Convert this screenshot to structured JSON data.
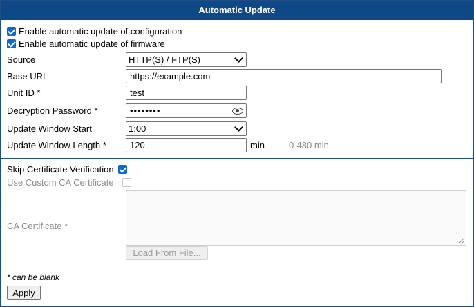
{
  "panel": {
    "title": "Automatic Update"
  },
  "options": {
    "enable_config": {
      "label": "Enable automatic update of configuration",
      "checked": true
    },
    "enable_firmware": {
      "label": "Enable automatic update of firmware",
      "checked": true
    }
  },
  "form": {
    "source": {
      "label": "Source",
      "value": "HTTP(S) / FTP(S)"
    },
    "base_url": {
      "label": "Base URL",
      "value": "https://example.com"
    },
    "unit_id": {
      "label": "Unit ID *",
      "value": "test"
    },
    "decryption_password": {
      "label": "Decryption Password *",
      "value": "••••••••"
    },
    "window_start": {
      "label": "Update Window Start",
      "value": "1:00"
    },
    "window_length": {
      "label": "Update Window Length *",
      "value": "120",
      "unit": "min",
      "hint": "0-480 min"
    }
  },
  "certificate": {
    "skip_verification": {
      "label": "Skip Certificate Verification",
      "checked": true
    },
    "use_custom_ca": {
      "label": "Use Custom CA Certificate",
      "checked": false,
      "disabled": true
    },
    "ca_certificate": {
      "label": "CA Certificate *",
      "value": ""
    },
    "load_button": "Load From File..."
  },
  "footer": {
    "note": "* can be blank",
    "apply_label": "Apply"
  },
  "colors": {
    "title_bg": "#0e4887",
    "checkbox": "#0a69d6",
    "border": "#1d4f86"
  }
}
